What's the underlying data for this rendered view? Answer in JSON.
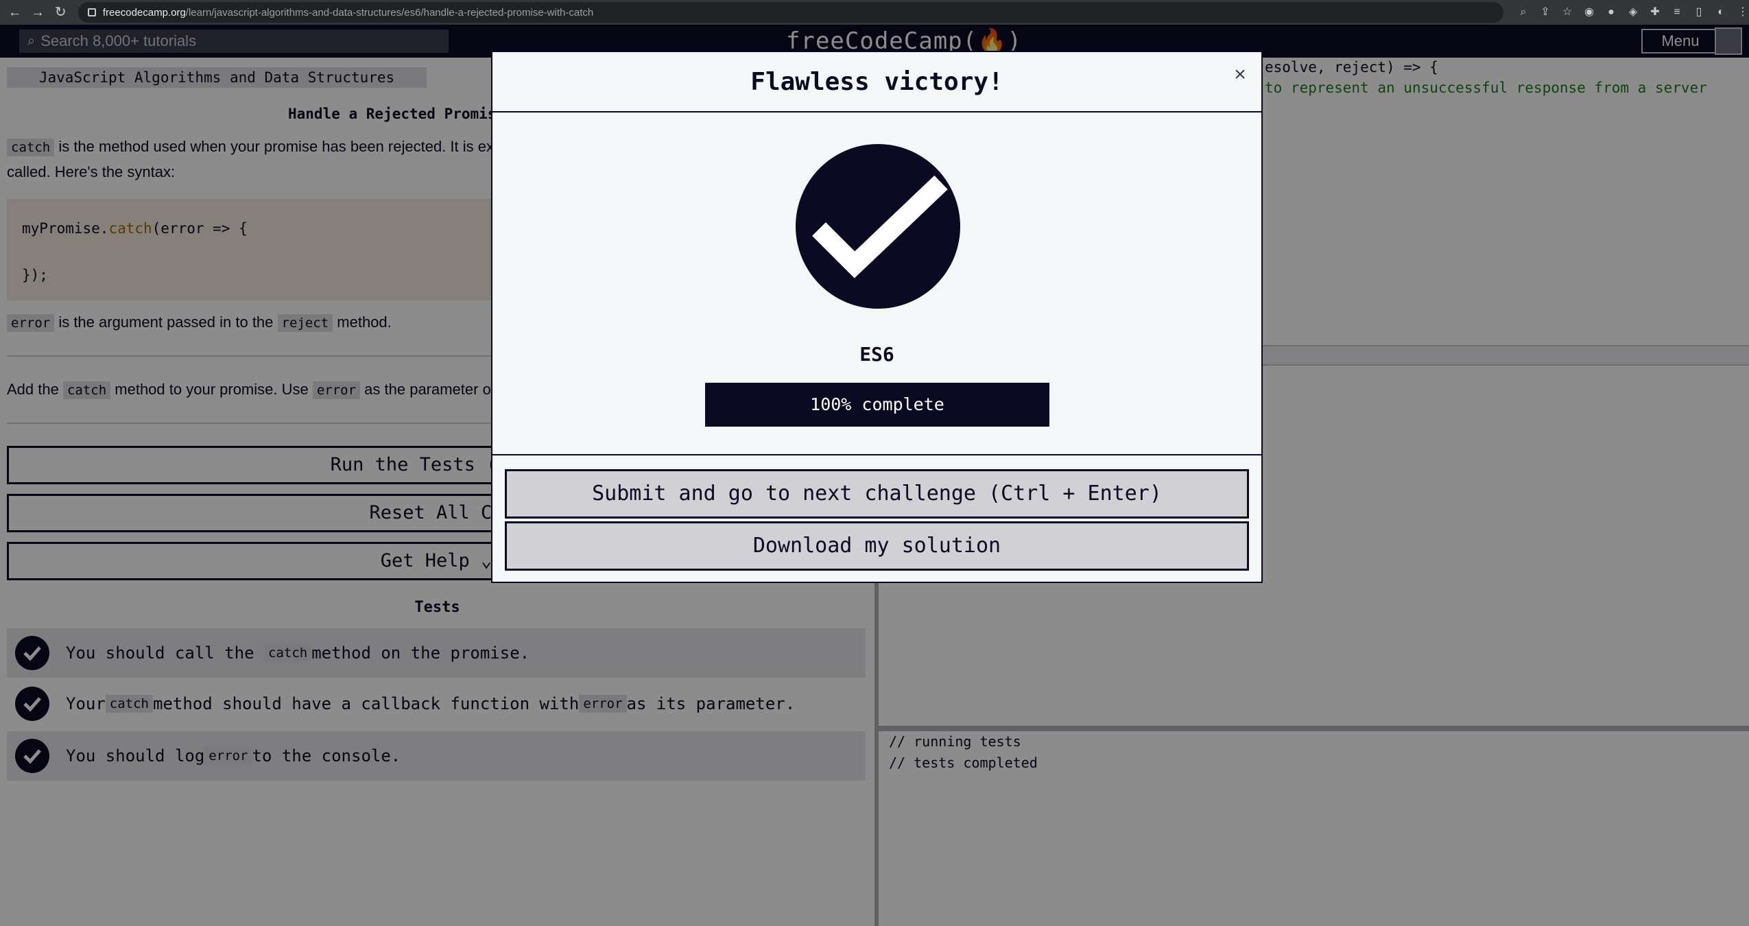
{
  "browser": {
    "url_host": "freecodecamp.org",
    "url_path": "/learn/javascript-algorithms-and-data-structures/es6/handle-a-rejected-promise-with-catch"
  },
  "navbar": {
    "search_placeholder": "Search 8,000+ tutorials",
    "brand": "freeCodeCamp(🔥)",
    "menu_label": "Menu"
  },
  "lesson": {
    "breadcrumb": "JavaScript Algorithms and Data Structures",
    "title": "Handle a Rejected Promise",
    "intro_code": "catch",
    "intro_text": " is the method used when your promise has been rejected. It is exe",
    "intro_text2": "called. Here's the syntax:",
    "code_lines": [
      "myPromise.",
      "catch",
      "(error => {",
      "",
      "});"
    ],
    "error_code": "error",
    "error_text1": " is the argument passed in to the ",
    "reject_code": "reject",
    "error_text2": " method.",
    "task_text1": "Add the ",
    "task_code1": "catch",
    "task_text2": " method to your promise. Use ",
    "task_code2": "error",
    "task_text3": " as the parameter of"
  },
  "buttons": {
    "run": "Run the Tests (Ctrl",
    "reset": "Reset All Co",
    "help": "Get Help ⌄"
  },
  "tests": {
    "heading": "Tests",
    "items": [
      {
        "pre": "You should call the ",
        "code": "catch",
        "post": " method on the promise."
      },
      {
        "pre": "Your ",
        "code": "catch",
        "mid": " method should have a callback function with ",
        "code2": "error",
        "post": " as its parameter."
      },
      {
        "pre": "You should log ",
        "code": "error",
        "post": " to the console."
      }
    ]
  },
  "editor": {
    "line1": "esolve, reject) => {",
    "line2": "to represent an unsuccessful response from a server"
  },
  "console": {
    "line1": "// running tests",
    "line2": "// tests completed"
  },
  "modal": {
    "title": "Flawless victory!",
    "close": "×",
    "block_name": "ES6",
    "progress_text": "100% complete",
    "progress_value": 1.0,
    "submit_label": "Submit and go to next challenge (Ctrl + Enter)",
    "download_label": "Download my solution"
  },
  "colors": {
    "primary": "#0a0a23",
    "code_bg": "#dfdfe2",
    "comment_green": "#1e7a1e"
  }
}
